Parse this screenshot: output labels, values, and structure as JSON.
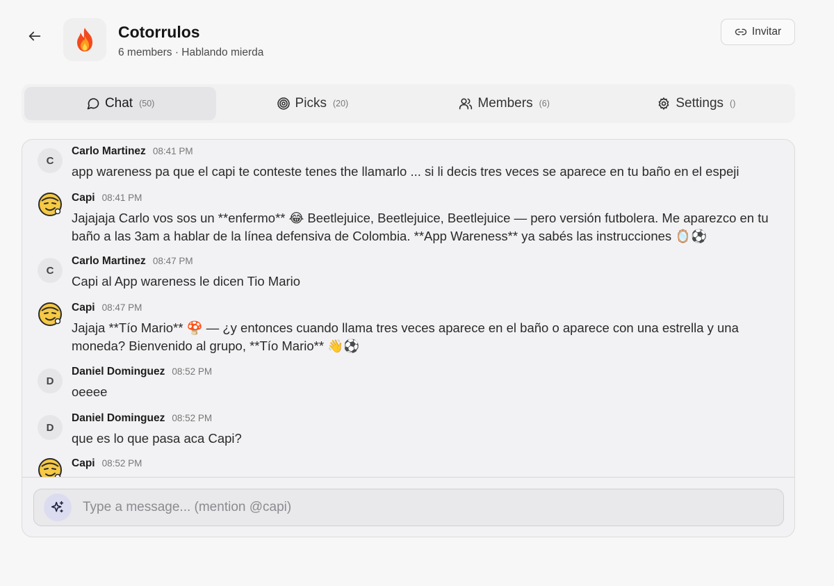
{
  "header": {
    "title": "Cotorrulos",
    "subtitle": "6 members · Hablando mierda",
    "avatar_emoji": "🔥",
    "invite_label": "Invitar",
    "back_icon": "arrow-left-icon",
    "invite_icon": "link-icon"
  },
  "tabs": [
    {
      "label": "Chat",
      "count": "(50)",
      "icon": "message-circle-icon",
      "active": true
    },
    {
      "label": "Picks",
      "count": "(20)",
      "icon": "target-icon",
      "active": false
    },
    {
      "label": "Members",
      "count": "(6)",
      "icon": "users-icon",
      "active": false
    },
    {
      "label": "Settings",
      "count": "()",
      "icon": "gear-icon",
      "active": false
    }
  ],
  "messages": [
    {
      "author": "Carlo Martinez",
      "initial": "C",
      "time": "08:41 PM",
      "text": "app wareness pa que el capi te conteste tenes the llamarlo ... si li decis tres veces se aparece en tu baño en el espeji"
    },
    {
      "author": "Capi",
      "initial": "",
      "time": "08:41 PM",
      "text": "Jajajaja Carlo vos sos un **enfermo** 😂 Beetlejuice, Beetlejuice, Beetlejuice — pero versión futbolera. Me aparezco en tu baño a las 3am a hablar de la línea defensiva de Colombia. **App Wareness** ya sabés las instrucciones 🪞⚽"
    },
    {
      "author": "Carlo Martinez",
      "initial": "C",
      "time": "08:47 PM",
      "text": "Capi al App wareness le dicen Tio Mario"
    },
    {
      "author": "Capi",
      "initial": "",
      "time": "08:47 PM",
      "text": "Jajaja **Tío Mario** 🍄 — ¿y entonces cuando llama tres veces aparece en el baño o aparece con una estrella y una moneda? Bienvenido al grupo, **Tío Mario** 👋⚽"
    },
    {
      "author": "Daniel Dominguez",
      "initial": "D",
      "time": "08:52 PM",
      "text": "oeeee"
    },
    {
      "author": "Daniel Dominguez",
      "initial": "D",
      "time": "08:52 PM",
      "text": "que es lo que pasa aca Capi?"
    },
    {
      "author": "Capi",
      "initial": "",
      "time": "08:52 PM",
      "text": ""
    }
  ],
  "composer": {
    "placeholder": "Type a message... (mention @capi)",
    "icon": "sparkles-icon"
  },
  "colors": {
    "background": "#f7f7f7",
    "active_tab": "#e5e5e8",
    "spark_button": "#dcdcf0"
  }
}
